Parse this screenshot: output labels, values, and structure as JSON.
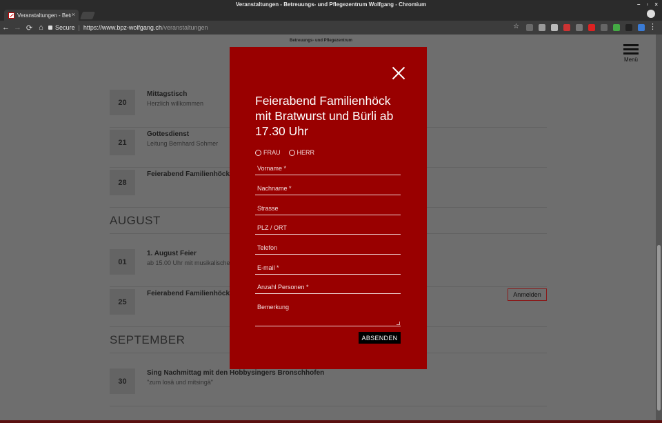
{
  "window": {
    "title": "Veranstaltungen - Betreuungs- und Pflegezentrum Wolfgang - Chromium",
    "controls": [
      "–",
      "▫",
      "×"
    ]
  },
  "tab": {
    "title": "Veranstaltungen - Betreuungs- und Pflegezentrum Wolfgang",
    "close": "×"
  },
  "toolbar": {
    "back": "←",
    "forward": "→",
    "reload": "⟳",
    "home": "⌂",
    "secure_label": "Secure",
    "url_host": "https://www.bpz-wolfgang.ch",
    "url_path": "/veranstaltungen",
    "star": "☆",
    "menu": "⋮"
  },
  "site": {
    "name": "Betreuungs- und Pflegezentrum",
    "menu_label": "Menü"
  },
  "events": [
    {
      "day": "20",
      "title": "Mittagstisch",
      "subtitle": "Herzlich willkommen"
    },
    {
      "day": "21",
      "title": "Gottesdienst",
      "subtitle": "Leitung Bernhard Sohmer"
    },
    {
      "day": "28",
      "title": "Feierabend Familienhöck",
      "subtitle": ""
    },
    {
      "day": "01",
      "title": "1. August Feier",
      "subtitle": "ab 15.00 Uhr mit musikalische"
    },
    {
      "day": "25",
      "title": "Feierabend Familienhöck",
      "subtitle": ""
    },
    {
      "day": "30",
      "title": "Sing Nachmittag mit den Hobbysingers Bronschhofen",
      "subtitle": "\"zum losä und mitsingä\""
    }
  ],
  "months": {
    "august": "AUGUST",
    "september": "SEPTEMBER"
  },
  "register_button": "Anmelden",
  "modal": {
    "title": "Feierabend Familienhöck mit Bratwurst und Bürli ab 17.30 Uhr",
    "salutation": {
      "frau": "FRAU",
      "herr": "HERR"
    },
    "fields": {
      "vorname": "Vorname *",
      "nachname": "Nachname *",
      "strasse": "Strasse",
      "plz_ort": "PLZ / ORT",
      "telefon": "Telefon",
      "email": "E-mail *",
      "personen": "Anzahl Personen *",
      "bemerkung": "Bemerkung"
    },
    "submit": "ABSENDEN"
  },
  "colors": {
    "modal_bg": "#990000",
    "overlay": "#6e6e6e",
    "accent": "#8a1a1a"
  }
}
